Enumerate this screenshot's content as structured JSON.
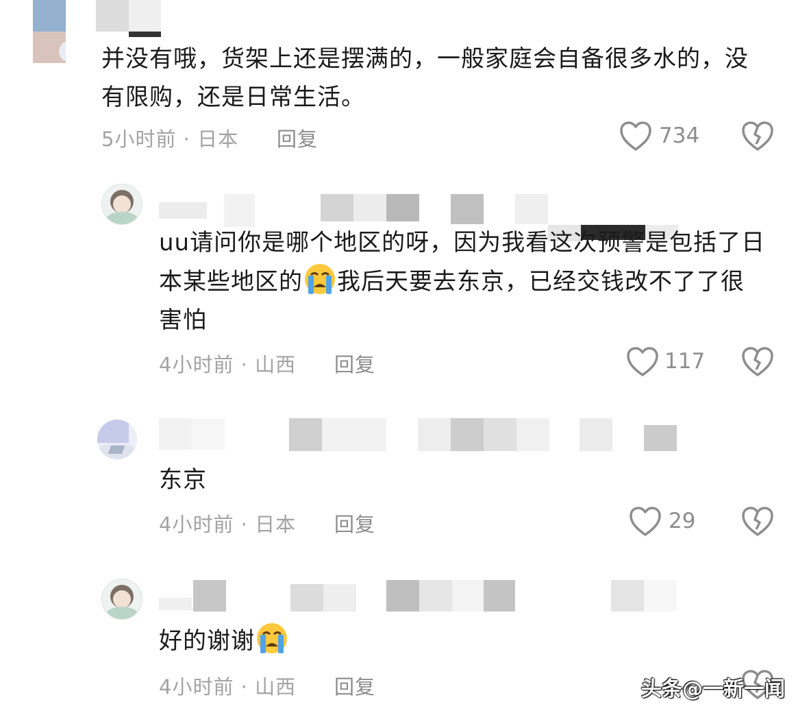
{
  "comments": [
    {
      "text_line1": "并没有哦，货架上还是摆满的，一般家庭会自备很多水的，没",
      "text_line2": "有限购，还是日常生活。",
      "meta": "5小时前 · 日本",
      "reply_label": "回复",
      "likes": "734"
    },
    {
      "text_line1": "uu请问你是哪个地区的呀，因为我看这次预警是包括了日",
      "text_line2a": "本某些地区的",
      "text_line2b": "我后天要去东京，已经交钱改不了了很",
      "text_line3": "害怕",
      "meta": "4小时前 · 山西",
      "reply_label": "回复",
      "likes": "117"
    },
    {
      "text_line1": "东京",
      "meta": "4小时前 · 日本",
      "reply_label": "回复",
      "likes": "29"
    },
    {
      "text_line1": "好的谢谢",
      "meta": "4小时前 · 山西",
      "reply_label": "回复"
    }
  ],
  "watermark": "头条@一新一闻",
  "icons": {
    "like": "heart-outline-icon",
    "dislike": "broken-heart-icon",
    "emoji": "crying-face-emoji"
  },
  "colors": {
    "text": "#1a1a1a",
    "meta": "#a3a3a3",
    "icon": "#8d8d8d",
    "emoji_face": "#ffc83d",
    "emoji_tears": "#4fa3e8"
  }
}
